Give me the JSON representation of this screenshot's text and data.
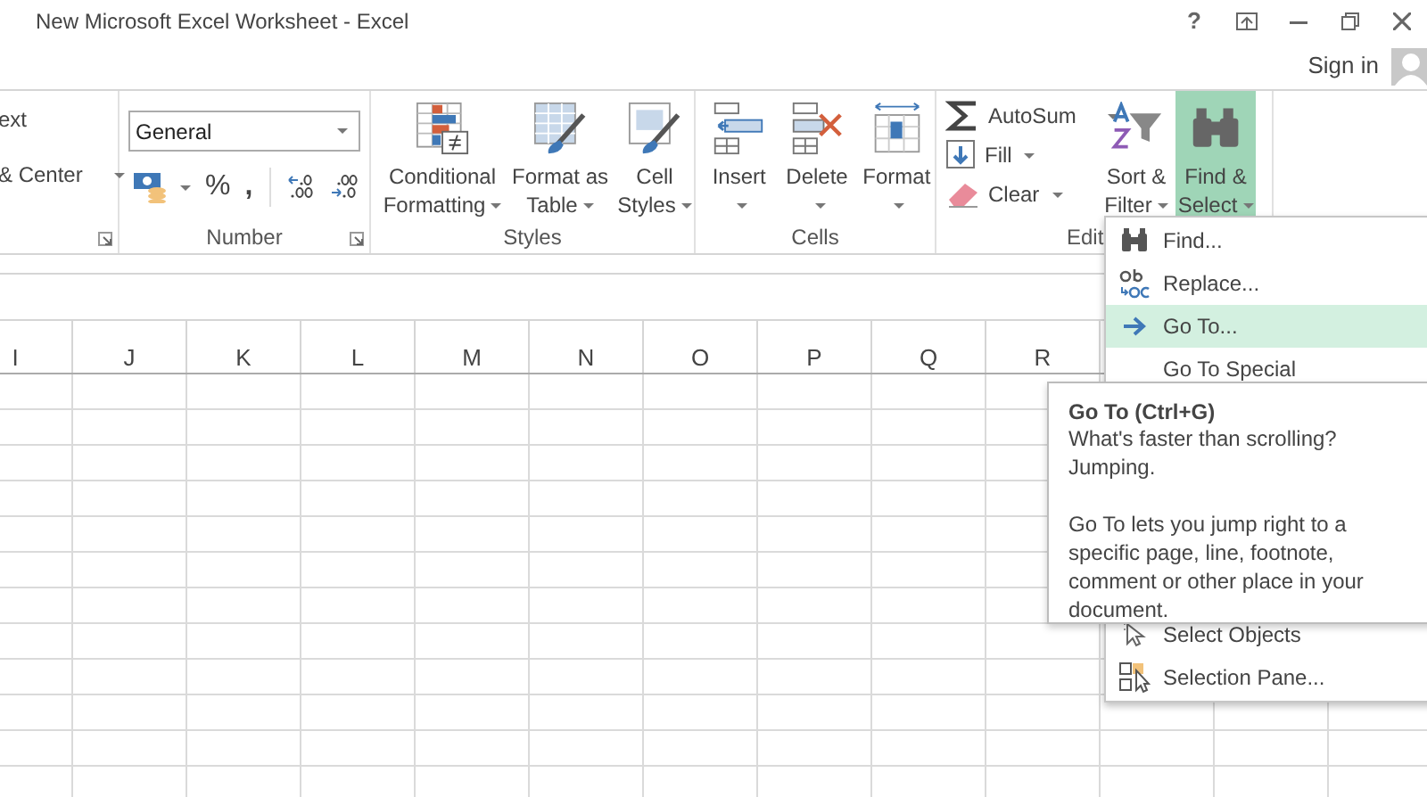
{
  "window": {
    "title": "New Microsoft Excel Worksheet - Excel",
    "help": "?"
  },
  "account": {
    "sign_in": "Sign in"
  },
  "ribbon": {
    "groups": [
      {
        "kind": "alignment",
        "items": [
          {
            "label": "ext",
            "dropdown": false
          },
          {
            "label": "& Center",
            "dropdown": true
          }
        ]
      },
      {
        "kind": "number",
        "label": "Number",
        "format": "General",
        "percent": "%",
        "comma": ","
      },
      {
        "kind": "large",
        "label": "Styles",
        "buttons": [
          {
            "kind": "conditional",
            "lines": [
              "Conditional",
              "Formatting"
            ]
          },
          {
            "kind": "table",
            "lines": [
              "Format as",
              "Table"
            ]
          },
          {
            "kind": "cellstyles",
            "lines": [
              "Cell",
              "Styles"
            ]
          }
        ]
      },
      {
        "kind": "large",
        "label": "Cells",
        "buttons": [
          {
            "kind": "insert",
            "lines": [
              "Insert"
            ]
          },
          {
            "kind": "delete",
            "lines": [
              "Delete"
            ]
          },
          {
            "kind": "format",
            "lines": [
              "Format"
            ]
          }
        ]
      },
      {
        "kind": "editing",
        "label": "Edit",
        "small": [
          {
            "kind": "autosum",
            "label": "AutoSum"
          },
          {
            "kind": "fill",
            "label": "Fill"
          },
          {
            "kind": "clear",
            "label": "Clear"
          }
        ],
        "buttons": [
          {
            "kind": "sort",
            "lines": [
              "Sort &",
              "Filter"
            ],
            "selected": false
          },
          {
            "kind": "find",
            "lines": [
              "Find &",
              "Select"
            ],
            "selected": true
          }
        ]
      }
    ]
  },
  "sheet": {
    "columns": [
      "I",
      "J",
      "K",
      "L",
      "M",
      "N",
      "O",
      "P",
      "Q",
      "R"
    ]
  },
  "menu": {
    "items": [
      {
        "kind": "find",
        "label": "Find...",
        "selected": false
      },
      {
        "kind": "replace",
        "label": "Replace...",
        "selected": false
      },
      {
        "kind": "goto",
        "label": "Go To...",
        "selected": true
      },
      {
        "kind": "special",
        "label": "Go To Special",
        "selected": false
      },
      {
        "kind": "gap"
      },
      {
        "kind": "objects",
        "label": "Select Objects",
        "selected": false
      },
      {
        "kind": "pane",
        "label": "Selection Pane...",
        "selected": false
      }
    ]
  },
  "tooltip": {
    "title": "Go To (Ctrl+G)",
    "paragraphs": [
      "What's faster than scrolling? Jumping.",
      "Go To lets you jump right to a specific page, line, footnote, comment or other place in your document."
    ]
  }
}
